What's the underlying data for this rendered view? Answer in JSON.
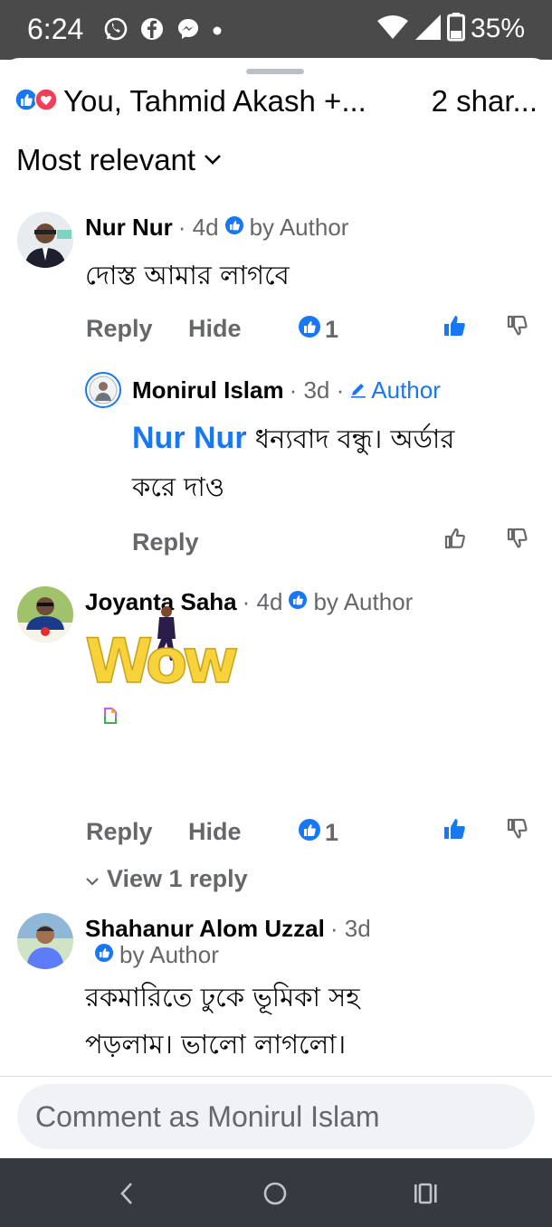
{
  "status_bar": {
    "time": "6:24",
    "battery": "35%",
    "icons": [
      "whatsapp-icon",
      "facebook-icon",
      "messenger-icon",
      "dot-icon",
      "wifi-icon",
      "signal-icon",
      "battery-icon"
    ]
  },
  "reactions": {
    "summary": "You, Tahmid Akash +...",
    "shares": "2 shar...",
    "icons": [
      "like-reaction-icon",
      "love-reaction-icon"
    ],
    "like_color": "#1877f2",
    "love_color": "#f33e58"
  },
  "sort": {
    "label": "Most relevant"
  },
  "comments": [
    {
      "author": "Nur Nur",
      "time": "· 4d",
      "badge": "by Author",
      "text": "দোস্ত আমার লাগবে",
      "reply_label": "Reply",
      "hide_label": "Hide",
      "likes": "1",
      "reply": {
        "author": "Monirul Islam",
        "time": "· 3d ·",
        "badge": "Author",
        "mention": "Nur Nur",
        "text_line1": " ধন্যবাদ বন্ধু।  অর্ডার",
        "text_line2": "করে দাও",
        "reply_label": "Reply"
      }
    },
    {
      "author": "Joyanta Saha",
      "time": "· 4d",
      "badge": "by Author",
      "sticker": "Wow",
      "reply_label": "Reply",
      "hide_label": "Hide",
      "likes": "1",
      "view_replies": "View 1 reply"
    },
    {
      "author": "Shahanur Alom Uzzal",
      "time": "· 3d",
      "badge": "by Author",
      "text_line1": "রকমারিতে ঢুকে ভূমিকা সহ",
      "text_line2": "পড়লাম। ভালো লাগলো।"
    }
  ],
  "composer": {
    "placeholder": "Comment as Monirul Islam"
  },
  "colors": {
    "accent": "#1877f2",
    "muted": "#65676b",
    "status_bar": "#4a4a4a",
    "nav_bar": "#343a40",
    "sticker_yellow": "#f7d23a"
  }
}
